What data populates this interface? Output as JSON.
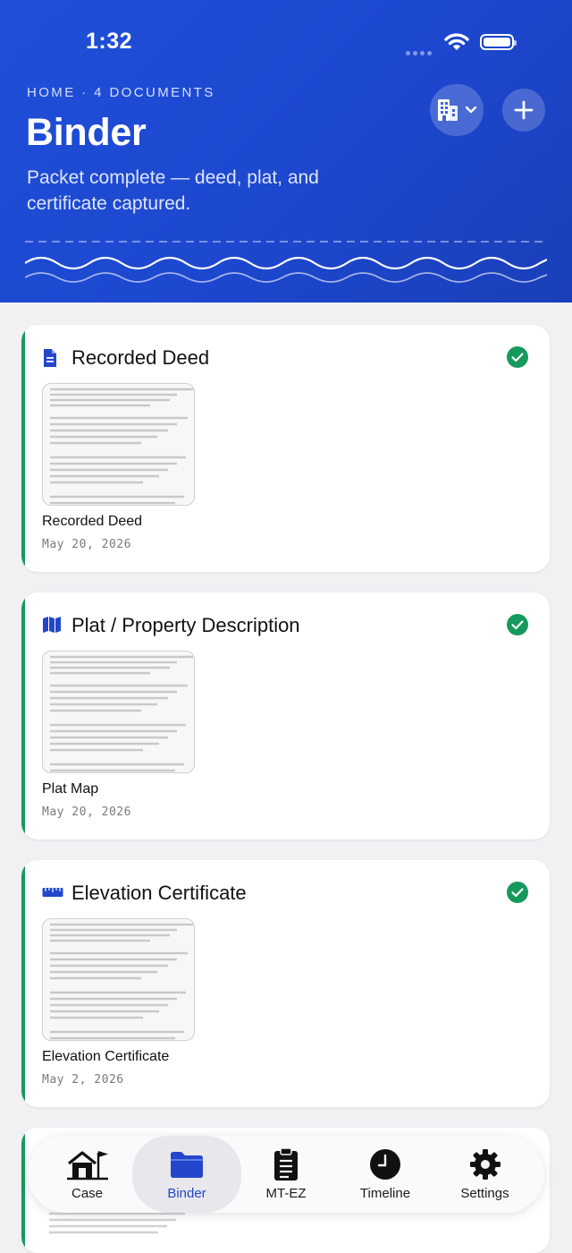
{
  "status_bar": {
    "time": "1:32"
  },
  "header": {
    "breadcrumb": "HOME · 4 DOCUMENTS",
    "title": "Binder",
    "subtitle": "Packet complete — deed, plat, and certificate captured."
  },
  "documents": [
    {
      "section_title": "Recorded Deed",
      "icon": "document-icon",
      "file_name": "Recorded Deed",
      "date": "May 20, 2026",
      "status": "complete"
    },
    {
      "section_title": "Plat / Property Description",
      "icon": "map-icon",
      "file_name": "Plat Map",
      "date": "May 20, 2026",
      "status": "complete"
    },
    {
      "section_title": "Elevation Certificate",
      "icon": "ruler-icon",
      "file_name": "Elevation Certificate",
      "date": "May 2, 2026",
      "status": "complete"
    }
  ],
  "tab_bar": {
    "tabs": [
      {
        "label": "Case",
        "icon": "house-icon"
      },
      {
        "label": "Binder",
        "icon": "folder-icon",
        "active": true
      },
      {
        "label": "MT-EZ",
        "icon": "clipboard-icon"
      },
      {
        "label": "Timeline",
        "icon": "clock-icon"
      },
      {
        "label": "Settings",
        "icon": "gear-icon"
      }
    ]
  },
  "colors": {
    "header_blue": "#1f4fd8",
    "accent_green": "#169a5c",
    "active_tab": "#2346cc"
  }
}
